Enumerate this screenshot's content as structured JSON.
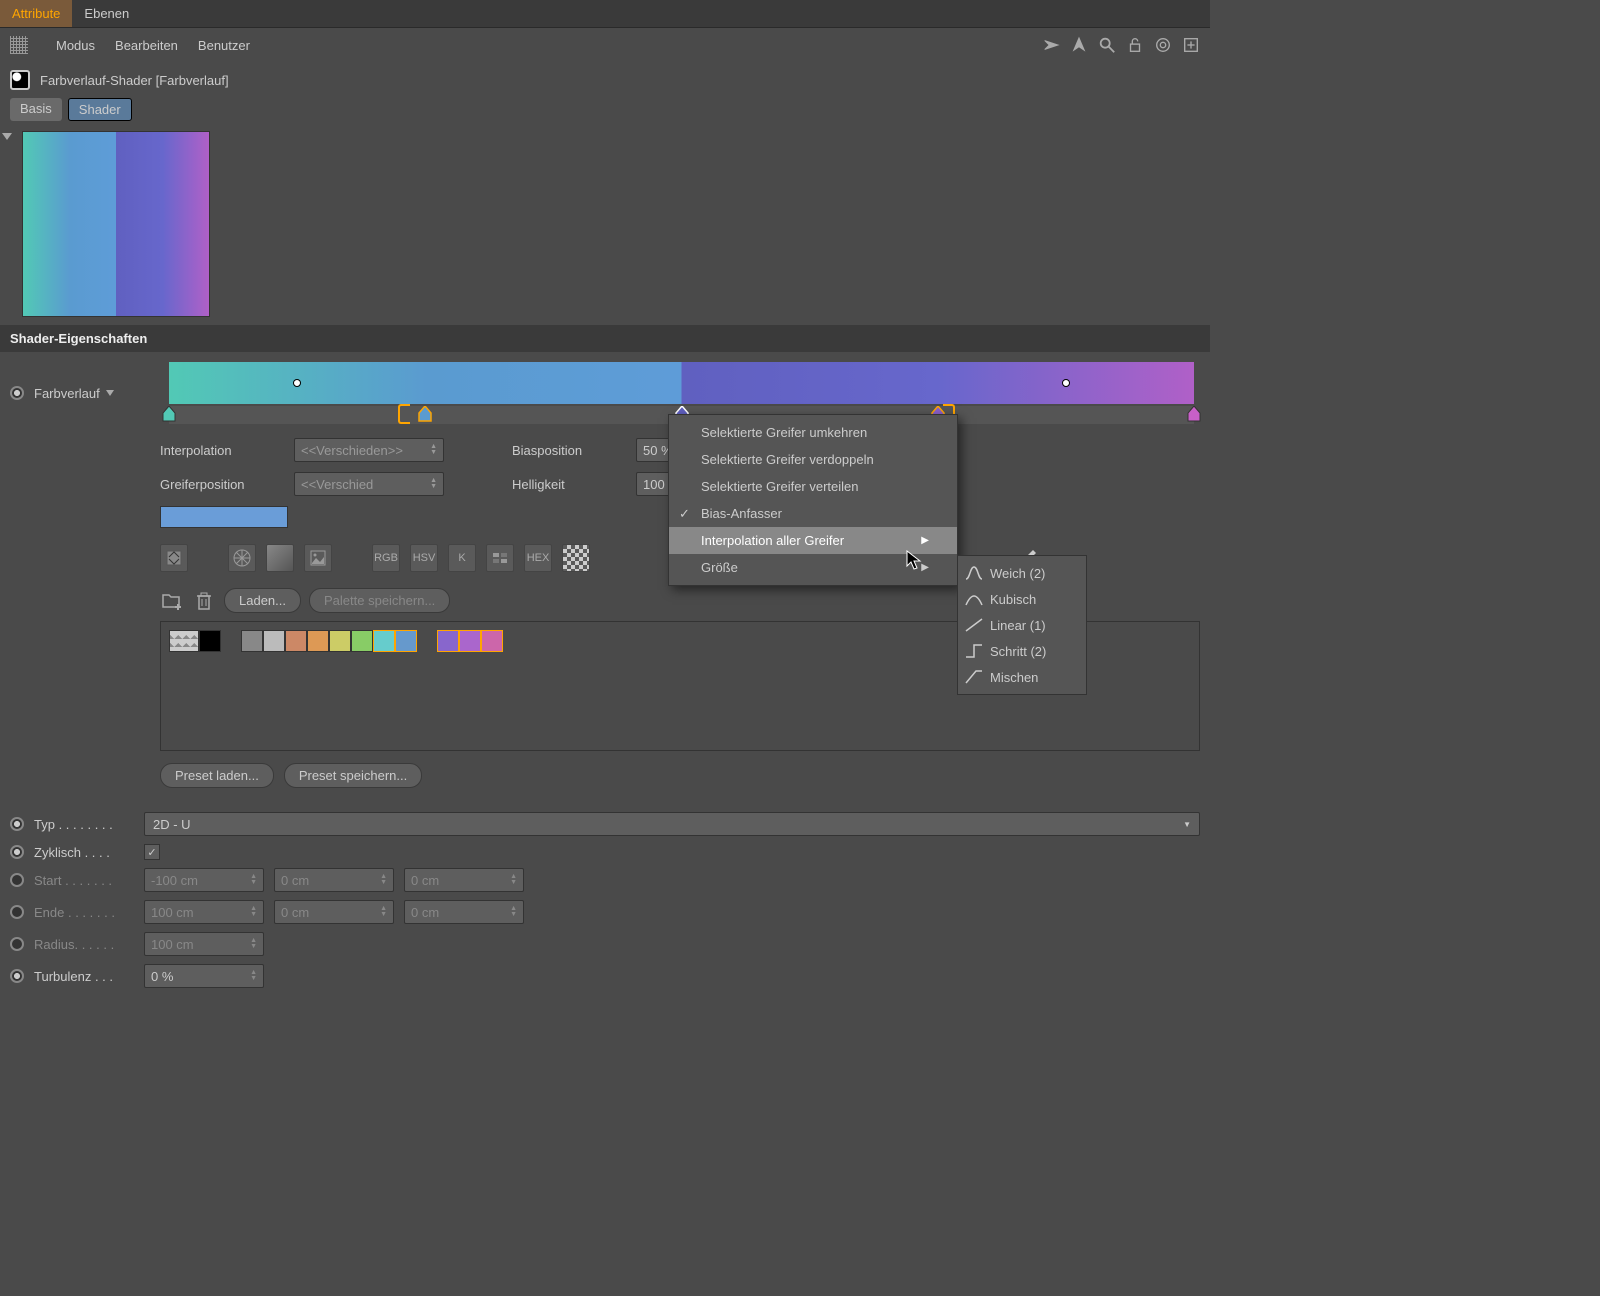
{
  "tabs": {
    "attribute": "Attribute",
    "ebenen": "Ebenen"
  },
  "menubar": {
    "modus": "Modus",
    "bearbeiten": "Bearbeiten",
    "benutzer": "Benutzer"
  },
  "title": "Farbverlauf-Shader [Farbverlauf]",
  "subtabs": {
    "basis": "Basis",
    "shader": "Shader"
  },
  "section": "Shader-Eigenschaften",
  "gradient": {
    "label": "Farbverlauf",
    "stops": [
      {
        "pos": 0,
        "color": "#52c9b5"
      },
      {
        "pos": 25,
        "color": "#5a9bd0"
      },
      {
        "pos": 50,
        "color": "#6060c0"
      },
      {
        "pos": 75,
        "color": "#8a60c8"
      },
      {
        "pos": 100,
        "color": "#c860c8"
      }
    ],
    "bias_dots": [
      12.5,
      87.5
    ],
    "selection_bracket": [
      23.5,
      76.5
    ]
  },
  "controls": {
    "interpolation": {
      "label": "Interpolation",
      "value": "<<Verschieden>>"
    },
    "greiferposition": {
      "label": "Greiferposition",
      "value": "<<Verschied"
    },
    "biasposition": {
      "label": "Biasposition",
      "value": "50 %"
    },
    "helligkeit": {
      "label": "Helligkeit",
      "value": "100 %"
    }
  },
  "colormodes": {
    "rgb": "RGB",
    "hsv": "HSV",
    "k": "K",
    "hex": "HEX"
  },
  "load": {
    "laden": "Laden...",
    "palette_speichern": "Palette speichern..."
  },
  "palette_colors": [
    "#000000",
    "#888888",
    "#bbbbbb",
    "#cc8866",
    "#dd9955",
    "#cccc66",
    "#88cc66",
    "#66cccc",
    "#6699cc",
    "#8866cc",
    "#aa66cc",
    "#cc66aa"
  ],
  "presets": {
    "laden": "Preset laden...",
    "speichern": "Preset speichern..."
  },
  "props": {
    "typ": {
      "label": "Typ",
      "value": "2D - U"
    },
    "zyklisch": {
      "label": "Zyklisch",
      "checked": true
    },
    "start": {
      "label": "Start",
      "v1": "-100 cm",
      "v2": "0 cm",
      "v3": "0 cm"
    },
    "ende": {
      "label": "Ende",
      "v1": "100 cm",
      "v2": "0 cm",
      "v3": "0 cm"
    },
    "radius": {
      "label": "Radius",
      "value": "100 cm"
    },
    "turbulenz": {
      "label": "Turbulenz",
      "value": "0 %"
    }
  },
  "context": {
    "umkehren": "Selektierte Greifer umkehren",
    "verdoppeln": "Selektierte Greifer verdoppeln",
    "verteilen": "Selektierte Greifer verteilen",
    "bias": "Bias-Anfasser",
    "interpolation": "Interpolation aller Greifer",
    "groesse": "Größe"
  },
  "submenu": {
    "weich": "Weich (2)",
    "kubisch": "Kubisch",
    "linear": "Linear (1)",
    "schritt": "Schritt (2)",
    "mischen": "Mischen"
  }
}
